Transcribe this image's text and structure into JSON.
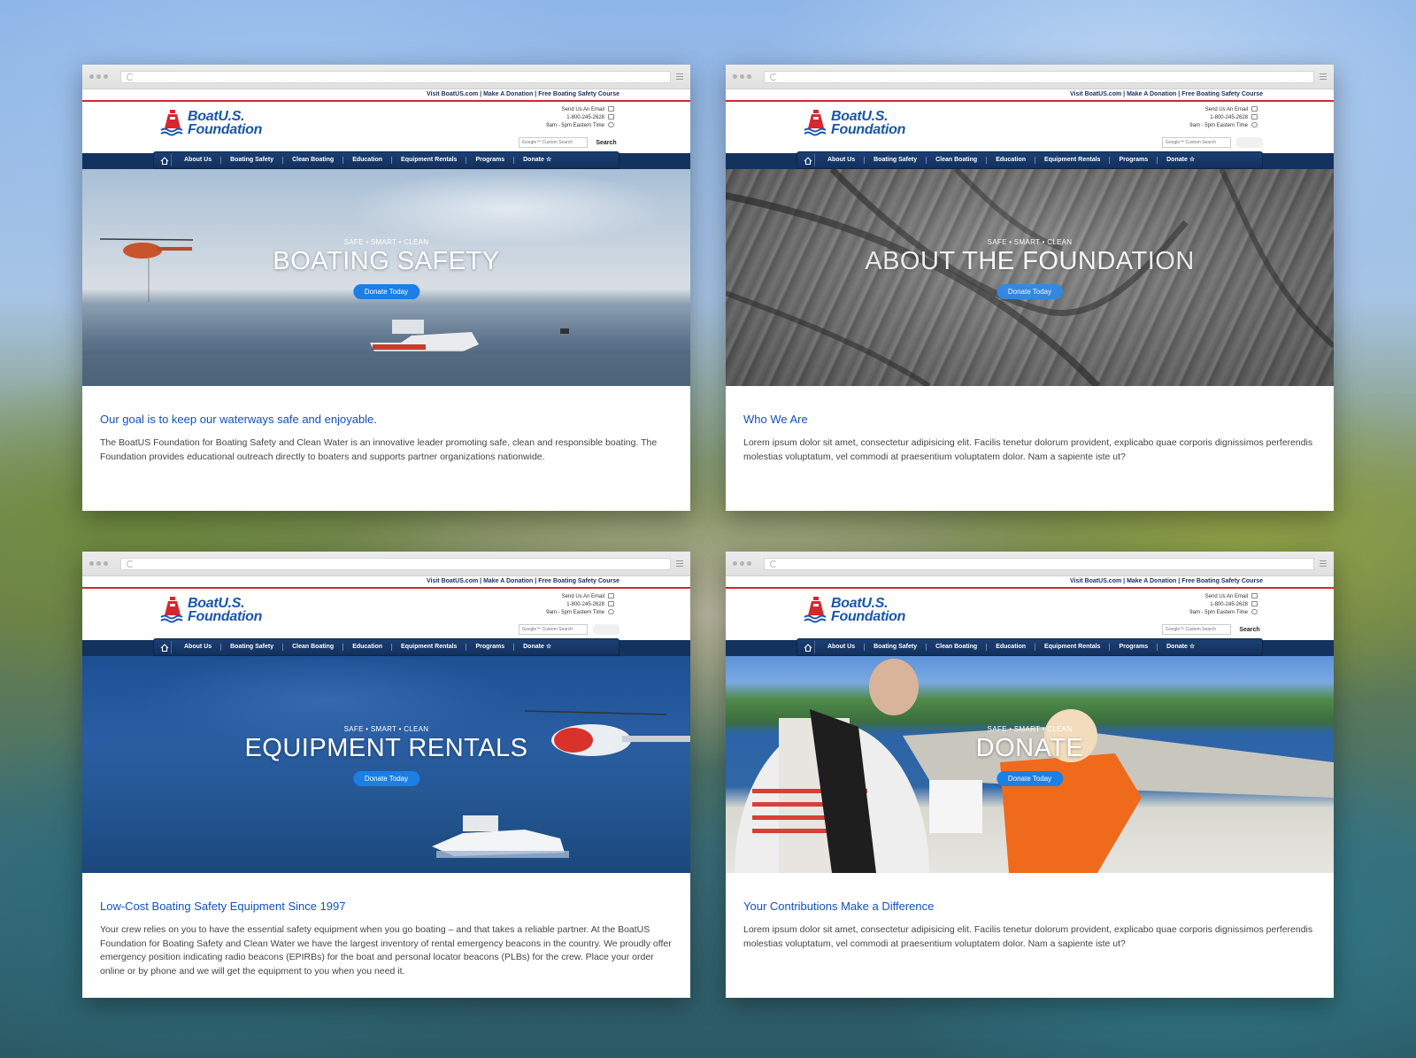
{
  "shared": {
    "util_links": [
      "Visit BoatUS.com",
      "Make A Donation",
      "Free Boating Safety Course"
    ],
    "util_sep": " | ",
    "logo_line1": "BoatU.S.",
    "logo_line2": "Foundation",
    "contact": {
      "email": "Send Us An Email",
      "phone": "1-800-245-2628",
      "hours": "9am - 5pm Eastern Time"
    },
    "search_placeholder": "Google™ Custom Search",
    "search_button": "Search",
    "nav": [
      "About Us",
      "Boating Safety",
      "Clean Boating",
      "Education",
      "Equipment Rentals",
      "Programs",
      "Donate"
    ],
    "hero_tag": "SAFE • SMART • CLEAN",
    "hero_button": "Donate Today"
  },
  "pages": [
    {
      "hero_title": "BOATING SAFETY",
      "heading": "Our goal is to keep our waterways safe and enjoyable.",
      "body": "The BoatUS Foundation for Boating Safety and Clean Water is an innovative leader promoting safe, clean and responsible boating. The Foundation provides educational outreach directly to boaters and supports partner organizations nationwide."
    },
    {
      "hero_title": "ABOUT THE FOUNDATION",
      "heading": "Who We Are",
      "body": "Lorem ipsum dolor sit amet, consectetur adipisicing elit. Facilis tenetur dolorum provident, explicabo quae corporis dignissimos perferendis molestias voluptatum, vel commodi at praesentium voluptatem dolor. Nam a sapiente iste ut?"
    },
    {
      "hero_title": "EQUIPMENT RENTALS",
      "heading": "Low-Cost Boating Safety Equipment Since 1997",
      "body": "Your crew relies on you to have the essential safety equipment when you go boating – and that takes a reliable partner. At the BoatUS Foundation for Boating Safety and Clean Water we have the largest inventory of rental emergency beacons in the country. We proudly offer emergency position indicating radio beacons (EPIRBs) for the boat and personal locator beacons (PLBs) for the crew. Place your order online or by phone and we will get the equipment to you when you need it."
    },
    {
      "hero_title": "DONATE",
      "heading": "Your Contributions Make a Difference",
      "body": "Lorem ipsum dolor sit amet, consectetur adipisicing elit. Facilis tenetur dolorum provident, explicabo quae corporis dignissimos perferendis molestias voluptatum, vel commodi at praesentium voluptatem dolor. Nam a sapiente iste ut?"
    }
  ],
  "colors": {
    "brand_blue": "#1a56a8",
    "nav_navy": "#14325e",
    "accent_red": "#d7262e",
    "button_blue": "#1b7fe5",
    "heading_blue": "#1450b8"
  }
}
